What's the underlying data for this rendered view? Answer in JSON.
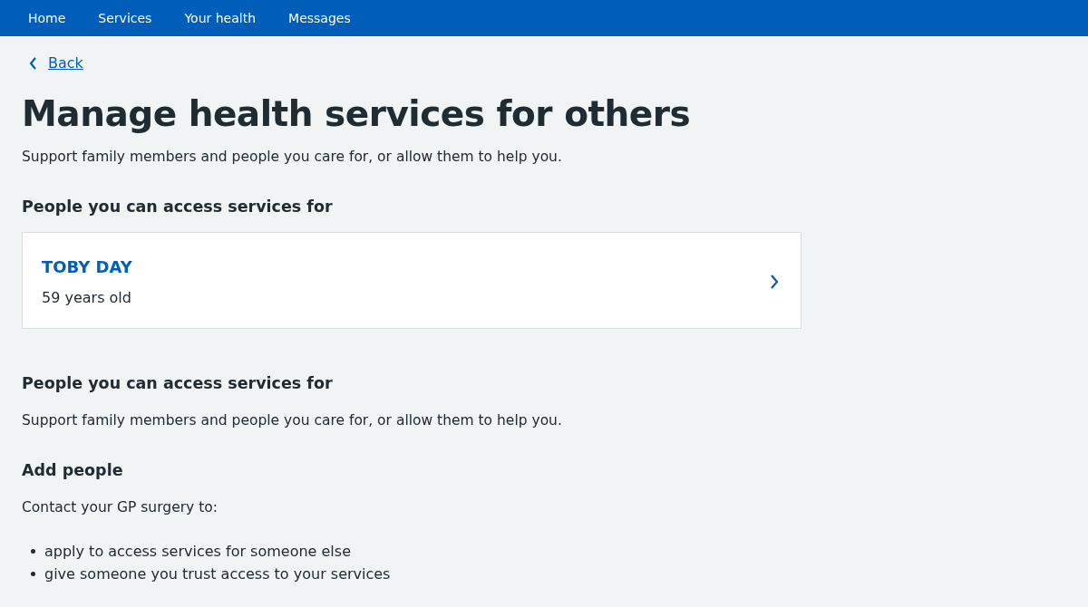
{
  "nav": [
    {
      "label": "Home"
    },
    {
      "label": "Services"
    },
    {
      "label": "Your health"
    },
    {
      "label": "Messages"
    }
  ],
  "back": {
    "label": "Back"
  },
  "title": "Manage health services for others",
  "intro": "Support family members and people you care for, or allow them to help you.",
  "section_1": {
    "heading": "People you can access services for"
  },
  "people": [
    {
      "name": "TOBY DAY",
      "age": "59 years old"
    }
  ],
  "section_2": {
    "heading": "People you can access services for",
    "text": "Support family members and people you care for, or allow them to help you."
  },
  "section_3": {
    "heading": "Add people",
    "text": "Contact your GP surgery to:",
    "bullets": [
      "apply to access services for someone else",
      "give someone you trust access to your services"
    ]
  }
}
